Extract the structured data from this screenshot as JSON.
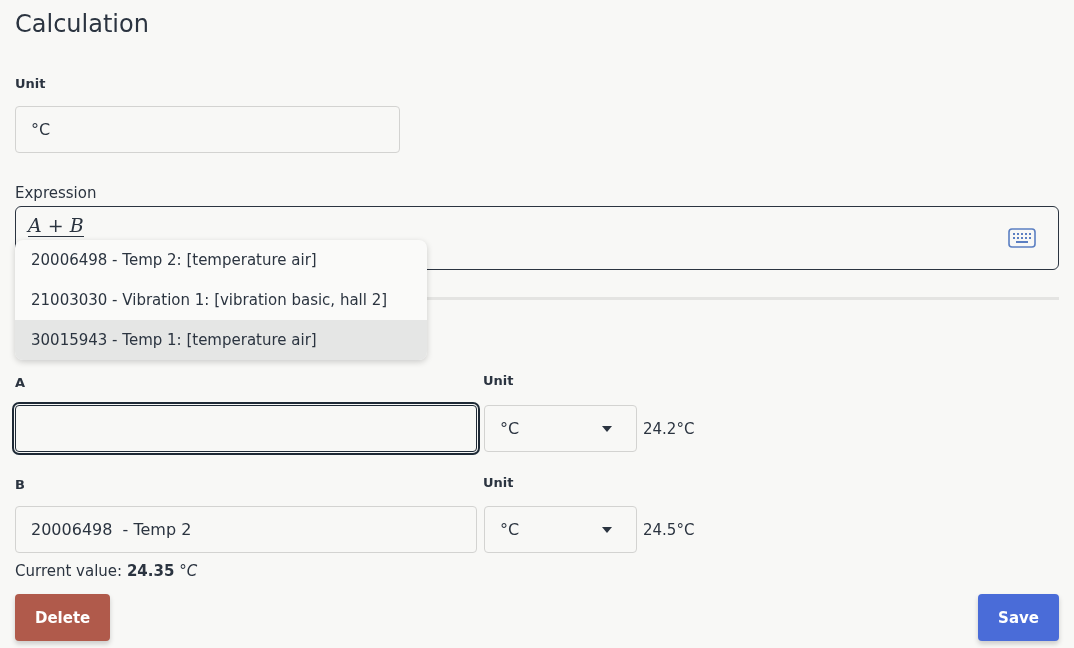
{
  "title": "Calculation",
  "unit_field": {
    "label": "Unit",
    "value": "°C"
  },
  "expression": {
    "label": "Expression",
    "value": "A + B"
  },
  "suggestions": [
    {
      "label": "20006498 - Temp 2: [temperature air]",
      "selected": false
    },
    {
      "label": "21003030 - Vibration 1: [vibration basic, hall 2]",
      "selected": false
    },
    {
      "label": "30015943 - Temp 1: [temperature air]",
      "selected": true
    }
  ],
  "variables": [
    {
      "name": "A",
      "focused": true,
      "unit_label": "Unit",
      "unit": "°C",
      "reading": "24.2°C"
    },
    {
      "name": "B",
      "value": "20006498  - Temp 2",
      "focused": false,
      "unit_label": "Unit",
      "unit": "°C",
      "reading": "24.5°C"
    }
  ],
  "current_value": "Current value: **24.35** *°C*",
  "buttons": [
    {
      "label": "Delete",
      "kind": "danger"
    },
    {
      "label": "Save",
      "kind": "primary"
    }
  ]
}
